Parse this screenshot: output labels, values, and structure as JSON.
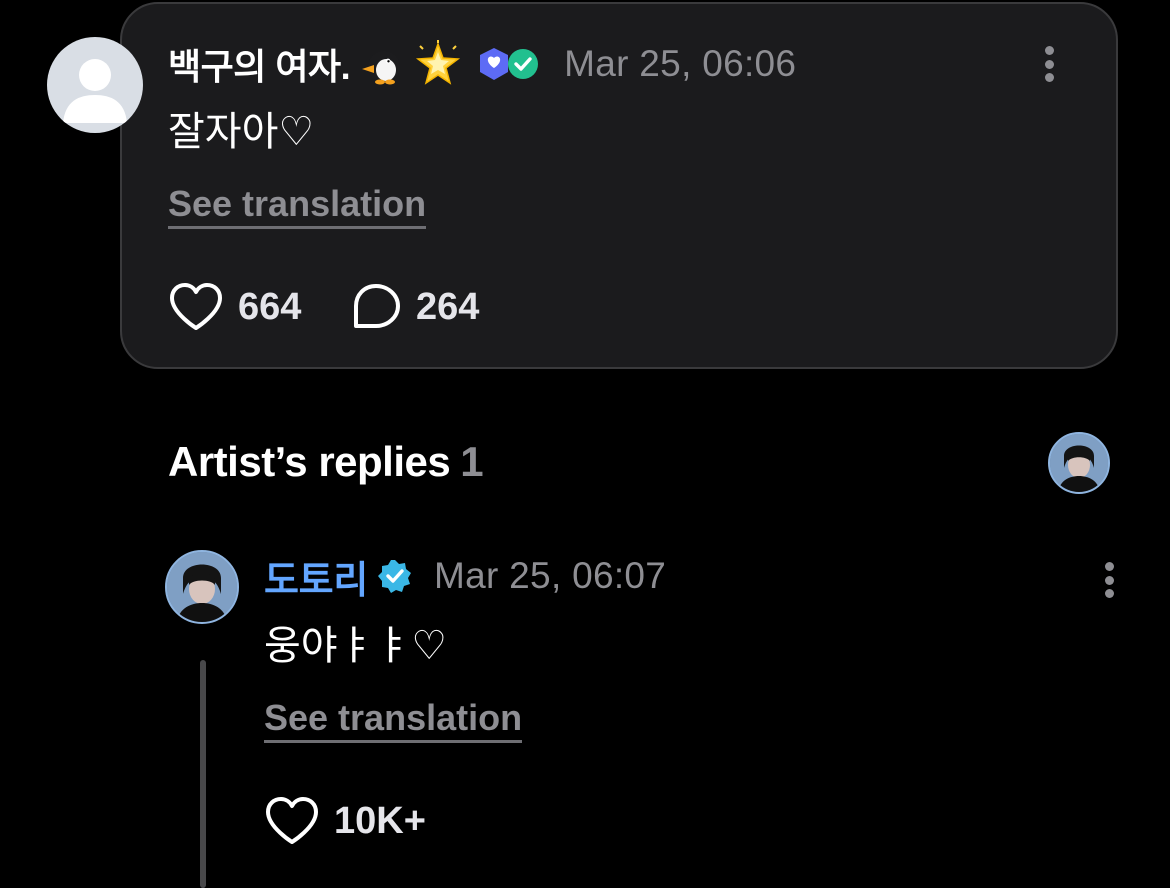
{
  "comment": {
    "username": "백구의 여자.",
    "badges": [
      "penguin-emoji",
      "glowing-star-emoji",
      "blue-heart-badge-icon",
      "green-check-badge-icon"
    ],
    "timestamp": "Mar 25, 06:06",
    "text": "잘자아♡",
    "see_translation": "See translation",
    "likes": "664",
    "replies": "264"
  },
  "artist_replies": {
    "title": "Artist’s replies",
    "count": "1"
  },
  "reply": {
    "username": "도토리",
    "verified": true,
    "timestamp": "Mar 25, 06:07",
    "text": "웅야ㅑㅑ♡",
    "see_translation": "See translation",
    "likes": "10K+"
  },
  "colors": {
    "background": "#000000",
    "card": "#1b1b1d",
    "artist_name": "#63a6ff",
    "muted_text": "#8e8e93",
    "verified_badge": "#3ab7e6"
  }
}
